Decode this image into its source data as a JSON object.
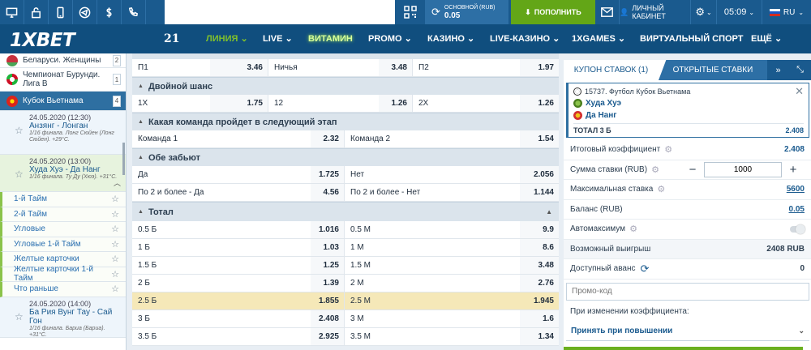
{
  "topbar": {
    "balance_label": "ОСНОВНОЙ (RUB)",
    "balance_value": "0.05",
    "deposit_label": "ПОПОЛНИТЬ",
    "cabinet_label": "ЛИЧНЫЙ КАБИНЕТ",
    "time": "05:09",
    "lang": "RU"
  },
  "logo": "1XBET",
  "nav": [
    "21",
    "ЛИНИЯ",
    "LIVE",
    "ВИТАМИН",
    "PROMO",
    "КАЗИНО",
    "LIVE-КАЗИНО",
    "1XGAMES",
    "ВИРТУАЛЬНЫЙ СПОРТ",
    "ЕЩЁ"
  ],
  "sidebar": {
    "leagues": [
      {
        "name": "Беларуси. Женщины",
        "count": "2"
      },
      {
        "name": "Чемпионат Бурунди. Лига B",
        "count": "1"
      },
      {
        "name": "Кубок Вьетнама",
        "count": "4"
      }
    ],
    "matches": [
      {
        "date": "24.05.2020 (12:30)",
        "teams": "Анзянг - Лонган",
        "note": "1/16 финала. Лонг Сюйен (Лонг Сюйен). +29°C."
      },
      {
        "date": "24.05.2020 (13:00)",
        "teams": "Худа Хуэ - Да Нанг",
        "note": "1/16 финала. Ту Ду (Хюэ). +31°C."
      },
      {
        "date": "24.05.2020 (14:00)",
        "teams": "Ба Рия Вунг Тау - Сай Гон",
        "note": "1/16 финала. Бариа (Бариа). +31°C."
      }
    ],
    "markets": [
      "1-й Тайм",
      "2-й Тайм",
      "Угловые",
      "Угловые 1-й Тайм",
      "Желтые карточки",
      "Желтые карточки 1-й Тайм",
      "Что раньше"
    ]
  },
  "markets": {
    "top_rows": [
      [
        {
          "n": "П1",
          "o": "3.46"
        },
        {
          "n": "Ничья",
          "o": "3.48"
        },
        {
          "n": "П2",
          "o": "1.97"
        }
      ]
    ],
    "double": {
      "title": "Двойной шанс",
      "rows": [
        [
          {
            "n": "1X",
            "o": "1.75"
          },
          {
            "n": "12",
            "o": "1.26"
          },
          {
            "n": "2X",
            "o": "1.26"
          }
        ]
      ]
    },
    "next": {
      "title": "Какая команда пройдет в следующий этап",
      "rows": [
        [
          {
            "n": "Команда 1",
            "o": "2.32"
          },
          {
            "n": "Команда 2",
            "o": "1.54"
          }
        ]
      ]
    },
    "both": {
      "title": "Обе забьют",
      "rows": [
        [
          {
            "n": "Да",
            "o": "1.725"
          },
          {
            "n": "Нет",
            "o": "2.056"
          }
        ],
        [
          {
            "n": "По 2 и более - Да",
            "o": "4.56"
          },
          {
            "n": "По 2 и более - Нет",
            "o": "1.144"
          }
        ]
      ]
    },
    "total": {
      "title": "Тотал",
      "rows": [
        [
          {
            "n": "0.5 Б",
            "o": "1.016"
          },
          {
            "n": "0.5 М",
            "o": "9.9"
          }
        ],
        [
          {
            "n": "1 Б",
            "o": "1.03"
          },
          {
            "n": "1 М",
            "o": "8.6"
          }
        ],
        [
          {
            "n": "1.5 Б",
            "o": "1.25"
          },
          {
            "n": "1.5 М",
            "o": "3.48"
          }
        ],
        [
          {
            "n": "2 Б",
            "o": "1.39"
          },
          {
            "n": "2 М",
            "o": "2.76"
          }
        ],
        [
          {
            "n": "2.5 Б",
            "o": "1.855"
          },
          {
            "n": "2.5 М",
            "o": "1.945"
          }
        ],
        [
          {
            "n": "3 Б",
            "o": "2.408"
          },
          {
            "n": "3 М",
            "o": "1.6"
          }
        ],
        [
          {
            "n": "3.5 Б",
            "o": "2.925"
          },
          {
            "n": "3.5 М",
            "o": "1.34"
          }
        ]
      ]
    }
  },
  "coupon": {
    "tab1": "КУПОН СТАВОК (1)",
    "tab2": "ОТКРЫТЫЕ СТАВКИ",
    "event": "15737. Футбол Кубок Вьетнама",
    "team1": "Худа Хуэ",
    "team2": "Да Нанг",
    "bet": "ТОТАЛ 3 Б",
    "bet_odd": "2.408",
    "total_coef_label": "Итоговый коэффициент",
    "total_coef": "2.408",
    "stake_label": "Сумма ставки (RUB)",
    "stake_value": "1000",
    "max_label": "Максимальная ставка",
    "max_value": "5600",
    "balance_label": "Баланс (RUB)",
    "balance_value": "0.05",
    "automax_label": "Автомаксимум",
    "win_label": "Возможный выигрыш",
    "win_value": "2408 RUB",
    "advance_label": "Доступный аванс",
    "advance_value": "0",
    "promo_placeholder": "Промо-код",
    "change_label": "При изменении коэффициента:",
    "change_value": "Принять при повышении"
  }
}
